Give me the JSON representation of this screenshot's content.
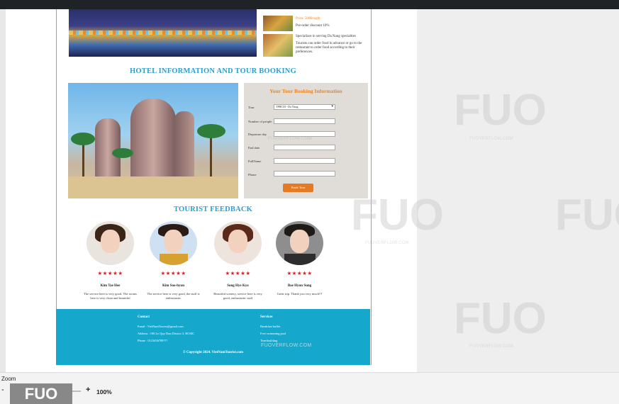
{
  "services": {
    "price": "Price: 500$/night",
    "discount": "Pre-order discount 10%",
    "specialize": "Specializes in serving Da Nang specialties",
    "order_text": "Tourists can order food in advance or go to the restaurant to order food according to their preferences."
  },
  "hotel_section": {
    "title": "HOTEL INFORMATION AND TOUR BOOKING"
  },
  "booking": {
    "title": "Your Tour Booking Information",
    "tour_label": "Tour",
    "tour_selected": "TPHCM - Da Nang",
    "people_label": "Number of people",
    "departure_label": "Departure day",
    "end_label": "End date",
    "name_label": "FullName",
    "phone_label": "Phone",
    "button": "Book Tour"
  },
  "feedback": {
    "title": "TOURIST FEEDBACK",
    "stars": "★★★★★",
    "reviews": [
      {
        "name": "Kim Tae Hee",
        "text": "The service here is very good. The rooms here is very clean and beautiful"
      },
      {
        "name": "Kim Soo-hyun",
        "text": "The service here is very good, the staff is enthusiastic"
      },
      {
        "name": "Song Hye Kyo",
        "text": "Beautiful scenery, service here is very good, enthusiastic staff"
      },
      {
        "name": "Bae Hyun Sung",
        "text": "Great trip. Thank you very much!!!"
      }
    ]
  },
  "footer": {
    "contact_heading": "Contact",
    "email": "Email : VietNamTourist@gmail.com",
    "address": "Address : 100 Le Quy Don,District 3, HCMC",
    "phone": "Phone : 0123456789???",
    "services_heading": "Services",
    "service_items": [
      "Breakfast buffet",
      "Free swimming pool",
      "Teambuilding"
    ],
    "copyright": "© Copyright 2024. VietNamTourist.com"
  },
  "watermark": {
    "logo": "FUO",
    "site": "FUOVERFLOW.COM"
  },
  "zoom": {
    "label": "Zoom",
    "minus": "-",
    "plus": "+",
    "value": "100%"
  },
  "colors": {
    "accent": "#2aa0d0",
    "orange": "#e6862b",
    "footer": "#16a7cd",
    "stars": "#e21b23"
  }
}
